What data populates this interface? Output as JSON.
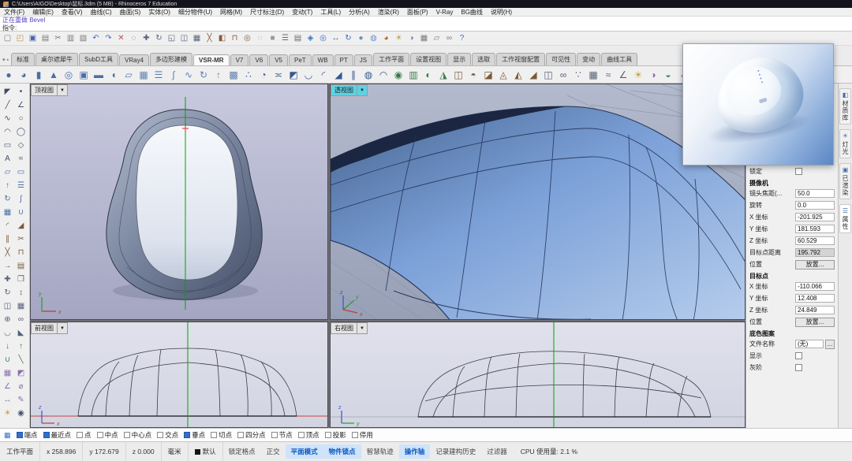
{
  "colors": {
    "active_viewport_label": "#5fd1e4",
    "surface_blue": "#7b9cd4",
    "wireframe_dark": "#223056",
    "axis_red": "#c23a3a",
    "axis_green": "#2d9a2d",
    "axis_blue": "#3a55c2",
    "command_history": "#5b41c8",
    "osnap_checked": "#2f6fd0",
    "layer_swatch": "#151515"
  },
  "titlebar": {
    "title": "C:\\Users\\AIGO\\Desktop\\鼠标.3dm (5 MB) - Rhinoceros 7 Education"
  },
  "menubar": {
    "items": [
      "文件(F)",
      "编辑(E)",
      "查看(V)",
      "曲线(C)",
      "曲面(S)",
      "实体(O)",
      "细分物件(U)",
      "网格(M)",
      "尺寸标注(D)",
      "变动(T)",
      "工具(L)",
      "分析(A)",
      "渲染(R)",
      "面板(P)",
      "V-Ray",
      "BG曲线",
      "说明(H)"
    ]
  },
  "command": {
    "history": "正在重做 Bevel",
    "prompt": "指令:"
  },
  "toolbar_main": {
    "icons": [
      {
        "name": "new-file-icon",
        "glyph": "▢",
        "color": "#7a7a7a"
      },
      {
        "name": "open-file-icon",
        "glyph": "◰",
        "color": "#c09040"
      },
      {
        "name": "save-icon",
        "glyph": "▣",
        "color": "#4466aa"
      },
      {
        "name": "print-icon",
        "glyph": "▤",
        "color": "#7a7a7a"
      },
      {
        "name": "cut-icon",
        "glyph": "✂",
        "color": "#7a7a7a"
      },
      {
        "name": "copy-icon",
        "glyph": "▥",
        "color": "#7a7a7a"
      },
      {
        "name": "paste-icon",
        "glyph": "▧",
        "color": "#7a7a7a"
      },
      {
        "name": "undo-icon",
        "glyph": "↶",
        "color": "#3a6fc4"
      },
      {
        "name": "redo-icon",
        "glyph": "↷",
        "color": "#3a6fc4"
      },
      {
        "name": "delete-icon",
        "glyph": "✕",
        "color": "#c05050"
      },
      {
        "name": "select-icon",
        "glyph": "◌",
        "color": "#6a6a6a"
      },
      {
        "name": "move-icon",
        "glyph": "✚",
        "color": "#55627a"
      },
      {
        "name": "rotate-icon",
        "glyph": "↻",
        "color": "#55627a"
      },
      {
        "name": "scale-icon",
        "glyph": "◱",
        "color": "#55627a"
      },
      {
        "name": "mirror-icon",
        "glyph": "◫",
        "color": "#55627a"
      },
      {
        "name": "array-icon",
        "glyph": "▦",
        "color": "#55627a"
      },
      {
        "name": "trim-icon",
        "glyph": "╳",
        "color": "#8a5a3a"
      },
      {
        "name": "split-icon",
        "glyph": "◧",
        "color": "#8a5a3a"
      },
      {
        "name": "join-icon",
        "glyph": "⊓",
        "color": "#8a5a3a"
      },
      {
        "name": "group-icon",
        "glyph": "◎",
        "color": "#8a5a3a"
      },
      {
        "name": "hide-icon",
        "glyph": "◌",
        "color": "#9a9a9a"
      },
      {
        "name": "lock-icon",
        "glyph": "■",
        "color": "#9a9a9a"
      },
      {
        "name": "layers-icon",
        "glyph": "☰",
        "color": "#6a6a6a"
      },
      {
        "name": "properties-icon",
        "glyph": "▤",
        "color": "#6a6a6a"
      },
      {
        "name": "zoom-extents-icon",
        "glyph": "◈",
        "color": "#3a6fc4"
      },
      {
        "name": "zoom-window-icon",
        "glyph": "◎",
        "color": "#3a6fc4"
      },
      {
        "name": "pan-icon",
        "glyph": "↔",
        "color": "#3a6fc4"
      },
      {
        "name": "rotate-view-icon",
        "glyph": "↻",
        "color": "#3a6fc4"
      },
      {
        "name": "shaded-view-icon",
        "glyph": "●",
        "color": "#6b8fc9"
      },
      {
        "name": "wireframe-view-icon",
        "glyph": "◍",
        "color": "#6b8fc9"
      },
      {
        "name": "render-icon",
        "glyph": "◕",
        "color": "#b0642a"
      },
      {
        "name": "light-icon",
        "glyph": "☀",
        "color": "#c2a040"
      },
      {
        "name": "material-icon",
        "glyph": "◑",
        "color": "#8a6fae"
      },
      {
        "name": "grid-icon",
        "glyph": "▦",
        "color": "#7a7a7a"
      },
      {
        "name": "cplane-icon",
        "glyph": "▱",
        "color": "#7a7a7a"
      },
      {
        "name": "history-icon",
        "glyph": "∞",
        "color": "#7a7a7a"
      },
      {
        "name": "help-icon",
        "glyph": "?",
        "color": "#3a6fc4"
      }
    ]
  },
  "tabrow": {
    "icons": [
      {
        "name": "pin-icon",
        "glyph": "▾"
      },
      {
        "name": "dock-icon",
        "glyph": "▪"
      }
    ],
    "tabs": [
      {
        "name": "tab-standard",
        "label": "标准"
      },
      {
        "name": "tab-gold-rhino",
        "label": "桌尔遮犀牛"
      },
      {
        "name": "tab-subd-tools",
        "label": "SubD工具"
      },
      {
        "name": "tab-vray4",
        "label": "VRay4"
      },
      {
        "name": "tab-polygon-modeling",
        "label": "多边形建模"
      },
      {
        "name": "tab-vsr-mr",
        "label": "VSR-MR",
        "active": true
      },
      {
        "name": "tab-v7",
        "label": "V7"
      },
      {
        "name": "tab-v6",
        "label": "V6"
      },
      {
        "name": "tab-v5",
        "label": "V5"
      },
      {
        "name": "tab-pet",
        "label": "PeT"
      },
      {
        "name": "tab-wb",
        "label": "WB"
      },
      {
        "name": "tab-pt",
        "label": "PT"
      },
      {
        "name": "tab-js",
        "label": "JS"
      },
      {
        "name": "tab-cplane",
        "label": "工作平面"
      },
      {
        "name": "tab-set-view",
        "label": "设置视图"
      },
      {
        "name": "tab-display",
        "label": "显示"
      },
      {
        "name": "tab-select",
        "label": "选取"
      },
      {
        "name": "tab-viewport-layout",
        "label": "工作视窗配置"
      },
      {
        "name": "tab-visibility",
        "label": "可见性"
      },
      {
        "name": "tab-transform",
        "label": "变动"
      },
      {
        "name": "tab-curve-tools",
        "label": "曲线工具"
      }
    ]
  },
  "toolbar_sub": {
    "icons": [
      {
        "name": "sphere-icon",
        "glyph": "●",
        "color": "#4a6fa5"
      },
      {
        "name": "ellipsoid-icon",
        "glyph": "◕",
        "color": "#4a6fa5"
      },
      {
        "name": "cylinder-icon",
        "glyph": "▮",
        "color": "#4a6fa5"
      },
      {
        "name": "cone-icon",
        "glyph": "▲",
        "color": "#4a6fa5"
      },
      {
        "name": "torus-icon",
        "glyph": "◎",
        "color": "#4a6fa5"
      },
      {
        "name": "box-icon",
        "glyph": "▣",
        "color": "#4a6fa5"
      },
      {
        "name": "pipe-icon",
        "glyph": "▬",
        "color": "#4a6fa5"
      },
      {
        "name": "half-sphere-icon",
        "glyph": "◖",
        "color": "#4a6fa5"
      },
      {
        "name": "plane-icon",
        "glyph": "▱",
        "color": "#5b7fb5"
      },
      {
        "name": "patch-icon",
        "glyph": "▦",
        "color": "#5b7fb5"
      },
      {
        "name": "loft-icon",
        "glyph": "☰",
        "color": "#5b7fb5"
      },
      {
        "name": "sweep1-icon",
        "glyph": "∫",
        "color": "#5b7fb5"
      },
      {
        "name": "sweep2-icon",
        "glyph": "∿",
        "color": "#5b7fb5"
      },
      {
        "name": "revolve-icon",
        "glyph": "↻",
        "color": "#5b7fb5"
      },
      {
        "name": "extrude-icon",
        "glyph": "↑",
        "color": "#5b7fb5"
      },
      {
        "name": "cage-edit-icon",
        "glyph": "▩",
        "color": "#5b7fb5"
      },
      {
        "name": "control-points-icon",
        "glyph": "∴",
        "color": "#36598f"
      },
      {
        "name": "rebuild-icon",
        "glyph": "◔",
        "color": "#36598f"
      },
      {
        "name": "match-surface-icon",
        "glyph": "≍",
        "color": "#36598f"
      },
      {
        "name": "merge-surface-icon",
        "glyph": "◩",
        "color": "#36598f"
      },
      {
        "name": "blend-surface-icon",
        "glyph": "◡",
        "color": "#36598f"
      },
      {
        "name": "fillet-surface-icon",
        "glyph": "◜",
        "color": "#36598f"
      },
      {
        "name": "chamfer-surface-icon",
        "glyph": "◢",
        "color": "#36598f"
      },
      {
        "name": "offset-surface-icon",
        "glyph": "∥",
        "color": "#36598f"
      },
      {
        "name": "shell-icon",
        "glyph": "◍",
        "color": "#36598f"
      },
      {
        "name": "unroll-icon",
        "glyph": "◠",
        "color": "#36598f"
      },
      {
        "name": "curvature-icon",
        "glyph": "◉",
        "color": "#3a7a4a"
      },
      {
        "name": "zebra-icon",
        "glyph": "▥",
        "color": "#3a7a4a"
      },
      {
        "name": "emap-icon",
        "glyph": "◐",
        "color": "#3a7a4a"
      },
      {
        "name": "draft-angle-icon",
        "glyph": "◮",
        "color": "#3a7a4a"
      },
      {
        "name": "edge-tools-icon",
        "glyph": "◫",
        "color": "#7a5a3a"
      },
      {
        "name": "isocurve-icon",
        "glyph": "◓",
        "color": "#7a5a3a"
      },
      {
        "name": "shrink-icon",
        "glyph": "◪",
        "color": "#7a5a3a"
      },
      {
        "name": "untrim-icon",
        "glyph": "◬",
        "color": "#7a5a3a"
      },
      {
        "name": "split-surface-icon",
        "glyph": "◭",
        "color": "#7a5a3a"
      },
      {
        "name": "trim-surface-icon",
        "glyph": "◢",
        "color": "#7a5a3a"
      },
      {
        "name": "symmetry-icon",
        "glyph": "◫",
        "color": "#555f75"
      },
      {
        "name": "record-history-icon",
        "glyph": "∞",
        "color": "#555f75"
      },
      {
        "name": "point-cloud-icon",
        "glyph": "∵",
        "color": "#555f75"
      },
      {
        "name": "mesh-tools-icon",
        "glyph": "▦",
        "color": "#555f75"
      },
      {
        "name": "nurbs-tools-icon",
        "glyph": "≈",
        "color": "#555f75"
      },
      {
        "name": "analyze-icon",
        "glyph": "∠",
        "color": "#555f75"
      },
      {
        "name": "render-light-icon",
        "glyph": "☀",
        "color": "#c2a040"
      },
      {
        "name": "render-material-icon",
        "glyph": "◑",
        "color": "#8a6fae"
      },
      {
        "name": "environment-icon",
        "glyph": "◒",
        "color": "#4a8a8a"
      },
      {
        "name": "render-settings-icon",
        "glyph": "◕",
        "color": "#b0642a"
      }
    ]
  },
  "sidebar": {
    "icons": [
      {
        "name": "select-pointer-icon",
        "glyph": "◤",
        "color": "#3f4a5e"
      },
      {
        "name": "point-icon",
        "glyph": "•",
        "color": "#3f4a5e"
      },
      {
        "name": "line-icon",
        "glyph": "╱",
        "color": "#44526b"
      },
      {
        "name": "polyline-icon",
        "glyph": "∠",
        "color": "#44526b"
      },
      {
        "name": "curve-icon",
        "glyph": "∿",
        "color": "#44526b"
      },
      {
        "name": "circle-icon",
        "glyph": "○",
        "color": "#44526b"
      },
      {
        "name": "arc-icon",
        "glyph": "◠",
        "color": "#44526b"
      },
      {
        "name": "ellipse-icon",
        "glyph": "◯",
        "color": "#44526b"
      },
      {
        "name": "rectangle-icon",
        "glyph": "▭",
        "color": "#44526b"
      },
      {
        "name": "polygon-icon",
        "glyph": "◇",
        "color": "#44526b"
      },
      {
        "name": "text-icon",
        "glyph": "A",
        "color": "#44526b"
      },
      {
        "name": "curve-tools-icon",
        "glyph": "≈",
        "color": "#44526b"
      },
      {
        "name": "surface-3pt-icon",
        "glyph": "▱",
        "color": "#4a6fa5"
      },
      {
        "name": "plane-surface-icon",
        "glyph": "▭",
        "color": "#4a6fa5"
      },
      {
        "name": "extrude-surface-icon",
        "glyph": "↑",
        "color": "#4a6fa5"
      },
      {
        "name": "loft-icon",
        "glyph": "☰",
        "color": "#4a6fa5"
      },
      {
        "name": "revolve-icon",
        "glyph": "↻",
        "color": "#4a6fa5"
      },
      {
        "name": "sweep-icon",
        "glyph": "∫",
        "color": "#4a6fa5"
      },
      {
        "name": "patch-icon",
        "glyph": "▦",
        "color": "#4a6fa5"
      },
      {
        "name": "blend-icon",
        "glyph": "∪",
        "color": "#4a6fa5"
      },
      {
        "name": "fillet-icon",
        "glyph": "◜",
        "color": "#7a5a3a"
      },
      {
        "name": "chamfer-icon",
        "glyph": "◢",
        "color": "#7a5a3a"
      },
      {
        "name": "offset-icon",
        "glyph": "∥",
        "color": "#7a5a3a"
      },
      {
        "name": "trim-icon",
        "glyph": "✂",
        "color": "#7a5a3a"
      },
      {
        "name": "split-icon",
        "glyph": "╳",
        "color": "#7a5a3a"
      },
      {
        "name": "join-icon",
        "glyph": "⊓",
        "color": "#7a5a3a"
      },
      {
        "name": "extend-icon",
        "glyph": "→",
        "color": "#7a5a3a"
      },
      {
        "name": "rebuild-icon",
        "glyph": "▤",
        "color": "#7a5a3a"
      },
      {
        "name": "move-icon",
        "glyph": "✚",
        "color": "#55627a"
      },
      {
        "name": "copy-icon",
        "glyph": "❐",
        "color": "#55627a"
      },
      {
        "name": "rotate-icon",
        "glyph": "↻",
        "color": "#55627a"
      },
      {
        "name": "scale-icon",
        "glyph": "↕",
        "color": "#55627a"
      },
      {
        "name": "mirror-icon",
        "glyph": "◫",
        "color": "#55627a"
      },
      {
        "name": "array-icon",
        "glyph": "▦",
        "color": "#55627a"
      },
      {
        "name": "orient-icon",
        "glyph": "⊕",
        "color": "#55627a"
      },
      {
        "name": "twist-icon",
        "glyph": "∞",
        "color": "#55627a"
      },
      {
        "name": "bend-icon",
        "glyph": "◡",
        "color": "#55627a"
      },
      {
        "name": "taper-icon",
        "glyph": "◣",
        "color": "#55627a"
      },
      {
        "name": "project-icon",
        "glyph": "↓",
        "color": "#3a7a4a"
      },
      {
        "name": "pull-icon",
        "glyph": "↑",
        "color": "#3a7a4a"
      },
      {
        "name": "boolean-union-icon",
        "glyph": "∪",
        "color": "#3a7a4a"
      },
      {
        "name": "boolean-difference-icon",
        "glyph": "╲",
        "color": "#3a7a4a"
      },
      {
        "name": "mesh-icon",
        "glyph": "▦",
        "color": "#8a6fae"
      },
      {
        "name": "subd-icon",
        "glyph": "◩",
        "color": "#8a6fae"
      },
      {
        "name": "analyze-icon",
        "glyph": "∠",
        "color": "#8a6fae"
      },
      {
        "name": "measure-icon",
        "glyph": "⌀",
        "color": "#8a6fae"
      },
      {
        "name": "dimension-icon",
        "glyph": "↔",
        "color": "#8a6fae"
      },
      {
        "name": "annotate-icon",
        "glyph": "✎",
        "color": "#8a6fae"
      },
      {
        "name": "light-tool-icon",
        "glyph": "☀",
        "color": "#c2a040"
      },
      {
        "name": "camera-tool-icon",
        "glyph": "◉",
        "color": "#44526b"
      }
    ]
  },
  "viewports": {
    "arrow": "▼",
    "top": {
      "label": "顶视图",
      "ax1": "x",
      "ax2": "y"
    },
    "persp": {
      "label": "透视图",
      "ax1": "x",
      "ax2": "y",
      "ax3": "z"
    },
    "front": {
      "label": "前视图",
      "ax1": "x",
      "ax2": "z"
    },
    "right": {
      "label": "右视图",
      "ax1": "y",
      "ax2": "z"
    }
  },
  "panel": {
    "lock_label": "锁定",
    "camera_header": "摄像机",
    "camera_rows": [
      {
        "label": "镜头焦距(...",
        "value": "50.0"
      },
      {
        "label": "旋转",
        "value": "0.0"
      },
      {
        "label": "X 坐标",
        "value": "-201.925"
      },
      {
        "label": "Y 坐标",
        "value": "181.593"
      },
      {
        "label": "Z 坐标",
        "value": "60.529"
      },
      {
        "label": "目标点距离",
        "value": "195.792",
        "muted": true
      }
    ],
    "position_label": "位置",
    "place_label": "放置...",
    "target_header": "目标点",
    "target_rows": [
      {
        "label": "X 坐标",
        "value": "-110.066"
      },
      {
        "label": "Y 坐标",
        "value": "12.408"
      },
      {
        "label": "Z 坐标",
        "value": "24.849"
      }
    ],
    "wallpaper_header": "底色图案",
    "filename_label": "文件名称",
    "filename_value": "(无)",
    "browse_label": "...",
    "show_label": "显示",
    "grayscale_label": "灰阶"
  },
  "rightstrip": {
    "tabs": [
      {
        "name": "tab-material-library",
        "icon": "◧",
        "label": "材质库"
      },
      {
        "name": "tab-lights",
        "icon": "☀",
        "label": "灯光"
      },
      {
        "name": "tab-rendered",
        "icon": "▣",
        "label": "已渲染"
      },
      {
        "name": "tab-properties",
        "icon": "☰",
        "label": "属性",
        "active": true
      }
    ]
  },
  "osnap": {
    "icon_glyph": "▦",
    "items": [
      {
        "name": "osnap-end",
        "label": "端点",
        "checked": true
      },
      {
        "name": "osnap-near",
        "label": "最近点",
        "checked": true
      },
      {
        "name": "osnap-point",
        "label": "点"
      },
      {
        "name": "osnap-mid",
        "label": "中点"
      },
      {
        "name": "osnap-center",
        "label": "中心点"
      },
      {
        "name": "osnap-intersection",
        "label": "交点"
      },
      {
        "name": "osnap-perpendicular",
        "label": "垂点",
        "checked": true
      },
      {
        "name": "osnap-tangent",
        "label": "切点"
      },
      {
        "name": "osnap-quadrant",
        "label": "四分点"
      },
      {
        "name": "osnap-knot",
        "label": "节点"
      },
      {
        "name": "osnap-vertex",
        "label": "顶点"
      },
      {
        "name": "osnap-project",
        "label": "投影"
      },
      {
        "name": "osnap-disable",
        "label": "停用"
      }
    ]
  },
  "statusbar": {
    "cplane_label": "工作平面",
    "coords": [
      "x 258.896",
      "y 172.679",
      "z 0.000"
    ],
    "units": "毫米",
    "layer": {
      "swatch": "#151515",
      "label": "默认"
    },
    "toggles": [
      {
        "name": "toggle-grid-snap",
        "label": "锁定格点"
      },
      {
        "name": "toggle-ortho",
        "label": "正交"
      },
      {
        "name": "toggle-planar",
        "label": "平面模式",
        "active": true
      },
      {
        "name": "toggle-osnap",
        "label": "物件锁点",
        "active": true
      },
      {
        "name": "toggle-smarttrack",
        "label": "智慧轨迹"
      },
      {
        "name": "toggle-gumball",
        "label": "操作轴",
        "active": true
      },
      {
        "name": "toggle-record-history",
        "label": "记录建构历史"
      },
      {
        "name": "toggle-filter",
        "label": "过滤器"
      }
    ],
    "cpu": "CPU 使用量: 2.1 %"
  }
}
